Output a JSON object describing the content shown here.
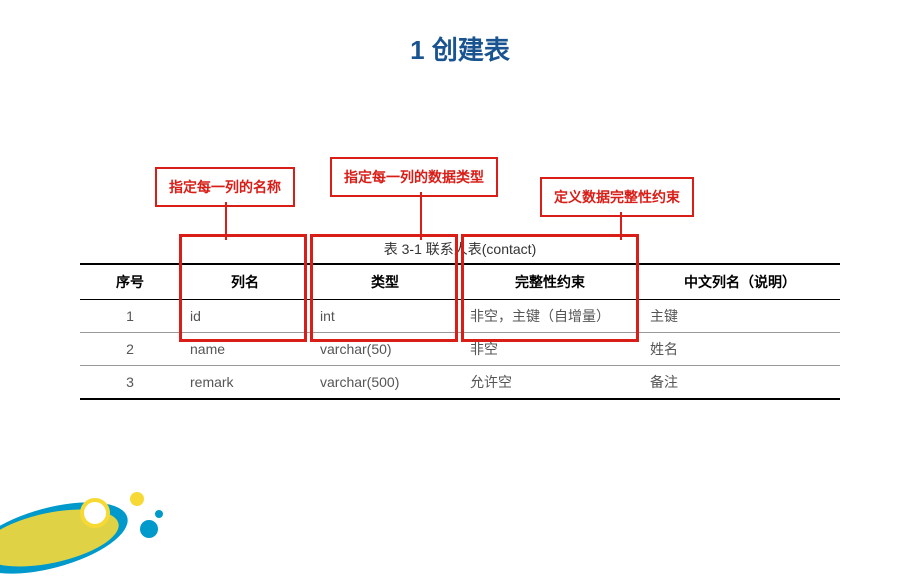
{
  "title": "1 创建表",
  "annotations": {
    "colname_label": "指定每一列的名称",
    "coltype_label": "指定每一列的数据类型",
    "constraint_label": "定义数据完整性约束"
  },
  "table_caption": "表 3-1 联系人表(contact)",
  "headers": {
    "seq": "序号",
    "colname": "列名",
    "coltype": "类型",
    "constraint": "完整性约束",
    "desc": "中文列名（说明）"
  },
  "rows": [
    {
      "seq": "1",
      "colname": "id",
      "coltype": "int",
      "constraint": "非空，主键（自增量）",
      "desc": "主键"
    },
    {
      "seq": "2",
      "colname": "name",
      "coltype": "varchar(50)",
      "constraint": "非空",
      "desc": "姓名"
    },
    {
      "seq": "3",
      "colname": "remark",
      "coltype": "varchar(500)",
      "constraint": "允许空",
      "desc": "备注"
    }
  ]
}
